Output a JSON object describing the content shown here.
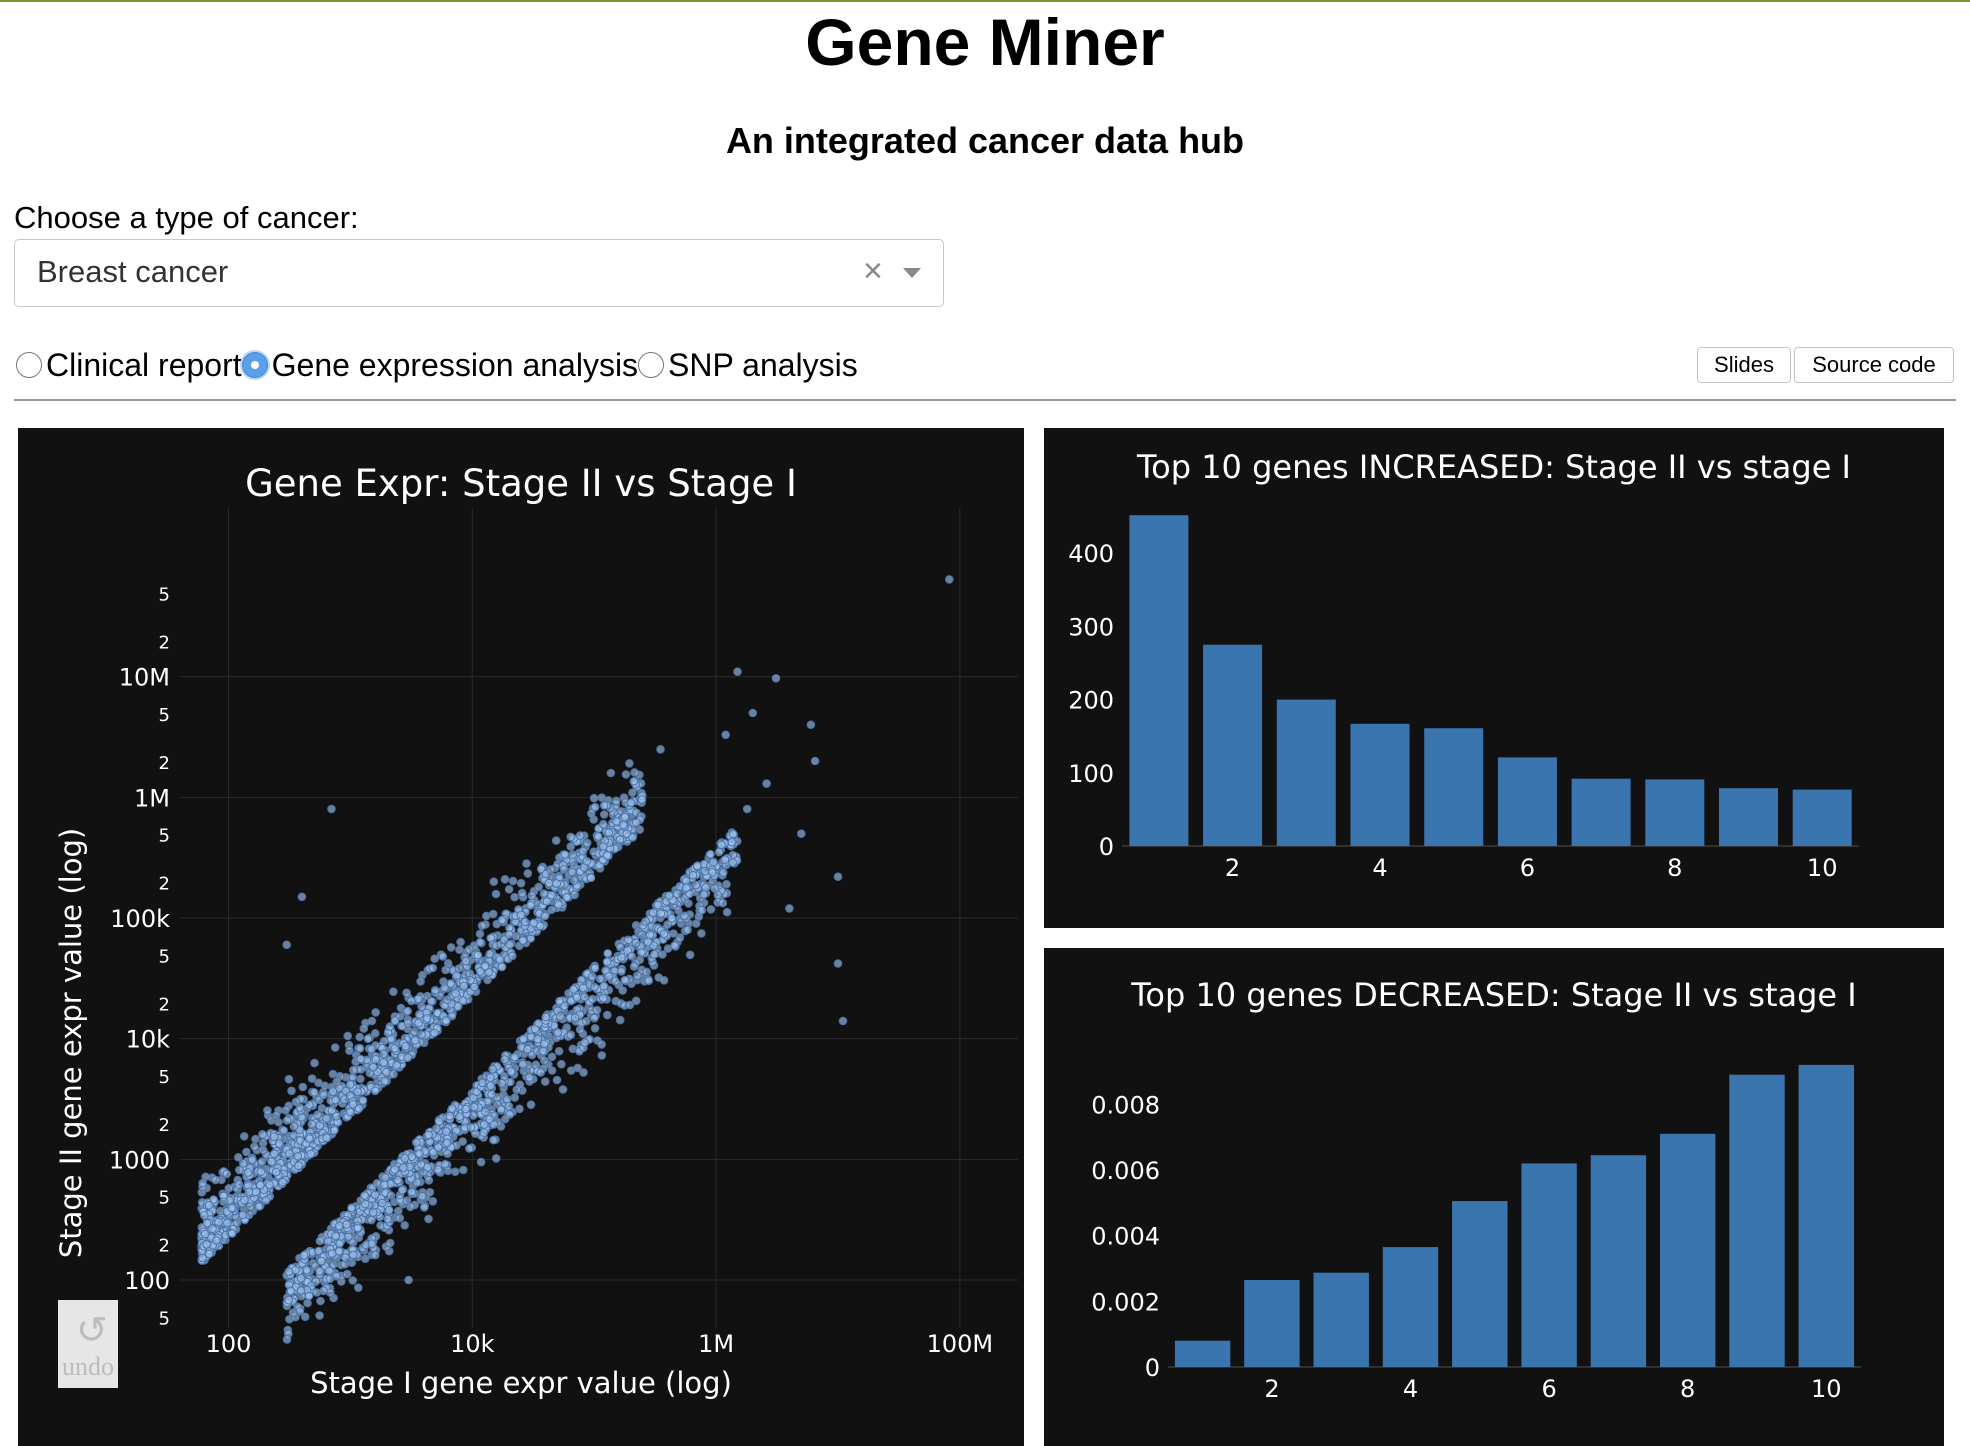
{
  "app": {
    "title": "Gene Miner",
    "subtitle": "An integrated cancer data hub",
    "accent_color": "#7a9a2e"
  },
  "cancer_select": {
    "label": "Choose a type of cancer:",
    "value": "Breast cancer",
    "clear_icon": "×"
  },
  "analysis_radio": {
    "options": [
      "Clinical report",
      "Gene expression analysis",
      "SNP analysis"
    ],
    "selected": "Gene expression analysis"
  },
  "buttons": {
    "slides": "Slides",
    "source_code": "Source code"
  },
  "undo": {
    "icon": "↺",
    "label": "undo"
  },
  "colors": {
    "panel_bg": "#111111",
    "bar": "#3b75af",
    "point_fill": "#9ec0e8",
    "point_stroke": "#4a73a8"
  },
  "chart_data": [
    {
      "type": "scatter",
      "title": "Gene Expr: Stage II vs Stage I",
      "xlabel": "Stage I gene expr value (log)",
      "ylabel": "Stage II gene expr value (log)",
      "x_scale": "log",
      "y_scale": "log",
      "xlim": [
        40,
        300000000
      ],
      "ylim": [
        40,
        250000000
      ],
      "x_ticks": [
        "100",
        "10k",
        "1M",
        "100M"
      ],
      "y_ticks": [
        "100",
        "1000",
        "10k",
        "100k",
        "1M",
        "10M"
      ],
      "y_minor_ticks": [
        "5",
        "2"
      ],
      "grid": true,
      "series": [
        {
          "x": [
            50,
            80,
            120,
            200,
            350,
            600,
            1000,
            2000,
            4000,
            8000,
            15000,
            30000,
            60000,
            120000,
            250000
          ],
          "y": [
            120,
            200,
            300,
            500,
            900,
            1500,
            2600,
            5200,
            10000,
            20000,
            38000,
            75000,
            150000,
            300000,
            600000
          ]
        },
        {
          "x": [
            300,
            600,
            1200,
            2500,
            5000,
            10000,
            20000,
            40000,
            80000,
            150000,
            300000,
            600000,
            1200000
          ],
          "y": [
            90,
            180,
            360,
            700,
            1400,
            2800,
            5500,
            11000,
            22000,
            42000,
            85000,
            170000,
            350000
          ]
        }
      ],
      "outliers": [
        {
          "x": 82000000,
          "y": 64000000
        },
        {
          "x": 1500000,
          "y": 11000000
        },
        {
          "x": 3100000,
          "y": 9700000
        },
        {
          "x": 2000000,
          "y": 5000000
        },
        {
          "x": 6000000,
          "y": 4000000
        },
        {
          "x": 1200000,
          "y": 3300000
        },
        {
          "x": 6500000,
          "y": 2000000
        },
        {
          "x": 2600000,
          "y": 1300000
        },
        {
          "x": 1800000,
          "y": 800000
        },
        {
          "x": 5000000,
          "y": 500000
        },
        {
          "x": 10000000,
          "y": 220000
        },
        {
          "x": 4000000,
          "y": 120000
        },
        {
          "x": 10000000,
          "y": 42000
        },
        {
          "x": 11000000,
          "y": 14000
        },
        {
          "x": 700,
          "y": 800000
        },
        {
          "x": 1500,
          "y": 14000
        },
        {
          "x": 1500,
          "y": 200
        },
        {
          "x": 3000,
          "y": 100
        },
        {
          "x": 350000,
          "y": 2500000
        },
        {
          "x": 200000,
          "y": 900000
        },
        {
          "x": 400,
          "y": 150000
        },
        {
          "x": 300,
          "y": 60000
        }
      ]
    },
    {
      "type": "bar",
      "title": "Top 10 genes INCREASED: Stage II vs stage I",
      "categories": [
        1,
        2,
        3,
        4,
        5,
        6,
        7,
        8,
        9,
        10
      ],
      "x_ticks": [
        2,
        4,
        6,
        8,
        10
      ],
      "values": [
        452,
        275,
        200,
        167,
        161,
        121,
        92,
        91,
        79,
        77
      ],
      "ylim": [
        0,
        470
      ],
      "y_ticks": [
        0,
        100,
        200,
        300,
        400
      ]
    },
    {
      "type": "bar",
      "title": "Top 10 genes DECREASED: Stage II vs stage I",
      "categories": [
        1,
        2,
        3,
        4,
        5,
        6,
        7,
        8,
        9,
        10
      ],
      "x_ticks": [
        2,
        4,
        6,
        8,
        10
      ],
      "values": [
        0.0008,
        0.00265,
        0.00287,
        0.00365,
        0.00505,
        0.0062,
        0.00645,
        0.0071,
        0.0089,
        0.0092
      ],
      "ylim": [
        0,
        0.0095
      ],
      "y_ticks": [
        "0",
        "0.002",
        "0.004",
        "0.006",
        "0.008"
      ]
    }
  ]
}
